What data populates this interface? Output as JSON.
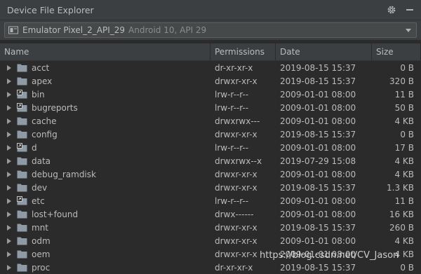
{
  "window": {
    "title": "Device File Explorer"
  },
  "device": {
    "name": "Emulator Pixel_2_API_29",
    "meta": "Android 10, API 29"
  },
  "columns": {
    "name": "Name",
    "permissions": "Permissions",
    "date": "Date",
    "size": "Size"
  },
  "files": [
    {
      "name": "acct",
      "perm": "dr-xr-xr-x",
      "date": "2019-08-15 15:37",
      "size": "0 B",
      "link": false
    },
    {
      "name": "apex",
      "perm": "drwxr-xr-x",
      "date": "2019-08-15 15:37",
      "size": "320 B",
      "link": false
    },
    {
      "name": "bin",
      "perm": "lrw-r--r--",
      "date": "2009-01-01 08:00",
      "size": "11 B",
      "link": true
    },
    {
      "name": "bugreports",
      "perm": "lrw-r--r--",
      "date": "2009-01-01 08:00",
      "size": "50 B",
      "link": true
    },
    {
      "name": "cache",
      "perm": "drwxrwx---",
      "date": "2009-01-01 08:00",
      "size": "4 KB",
      "link": false
    },
    {
      "name": "config",
      "perm": "drwxr-xr-x",
      "date": "2019-08-15 15:37",
      "size": "0 B",
      "link": false
    },
    {
      "name": "d",
      "perm": "lrw-r--r--",
      "date": "2009-01-01 08:00",
      "size": "17 B",
      "link": true
    },
    {
      "name": "data",
      "perm": "drwxrwx--x",
      "date": "2019-07-29 15:08",
      "size": "4 KB",
      "link": false
    },
    {
      "name": "debug_ramdisk",
      "perm": "drwxr-xr-x",
      "date": "2009-01-01 08:00",
      "size": "4 KB",
      "link": false
    },
    {
      "name": "dev",
      "perm": "drwxr-xr-x",
      "date": "2019-08-15 15:37",
      "size": "1.3 KB",
      "link": false
    },
    {
      "name": "etc",
      "perm": "lrw-r--r--",
      "date": "2009-01-01 08:00",
      "size": "11 B",
      "link": true
    },
    {
      "name": "lost+found",
      "perm": "drwx------",
      "date": "2009-01-01 08:00",
      "size": "16 KB",
      "link": false
    },
    {
      "name": "mnt",
      "perm": "drwxr-xr-x",
      "date": "2019-08-15 15:37",
      "size": "260 B",
      "link": false
    },
    {
      "name": "odm",
      "perm": "drwxr-xr-x",
      "date": "2009-01-01 08:00",
      "size": "4 KB",
      "link": false
    },
    {
      "name": "oem",
      "perm": "drwxr-xr-x",
      "date": "2009-01-01 08:00",
      "size": "4 KB",
      "link": false
    },
    {
      "name": "proc",
      "perm": "dr-xr-xr-x",
      "date": "2019-08-15 15:37",
      "size": "0 B",
      "link": false
    }
  ],
  "watermark": "https://blog.csdn.net/CV_Jason",
  "colors": {
    "folder": "#8e9aa6",
    "arrow": "#9a9a9a",
    "background": "#2b2b2b",
    "panel": "#3c3f41"
  }
}
